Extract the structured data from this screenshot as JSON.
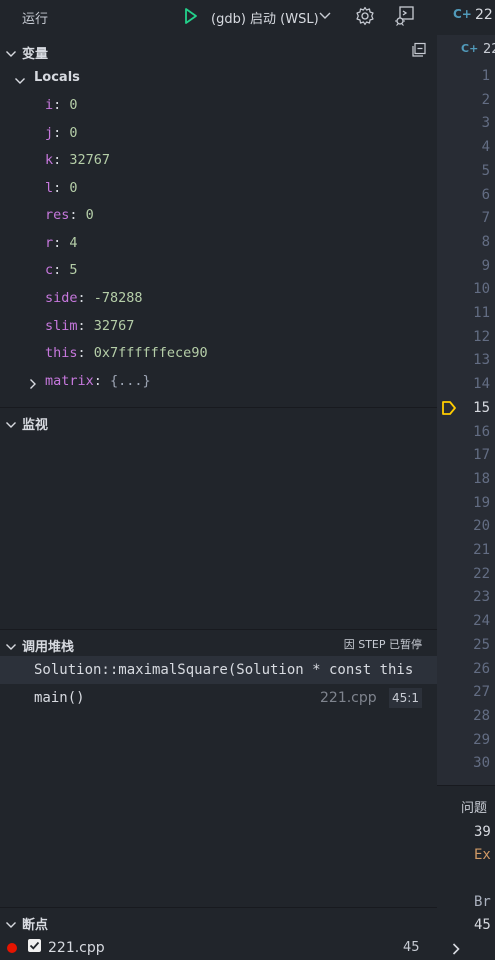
{
  "colors": {
    "accent_play": "#23d18b",
    "breakpoint": "#e51400",
    "debug_arrow": "#ffcc00",
    "var_name": "#c678dd",
    "var_value": "#b5cea8"
  },
  "toolbar": {
    "title": "运行",
    "config": "(gdb) 启动 (WSL)"
  },
  "variables": {
    "header": "变量",
    "scope": "Locals",
    "items": [
      {
        "name": "i",
        "value": "0"
      },
      {
        "name": "j",
        "value": "0"
      },
      {
        "name": "k",
        "value": "32767"
      },
      {
        "name": "l",
        "value": "0"
      },
      {
        "name": "res",
        "value": "0"
      },
      {
        "name": "r",
        "value": "4"
      },
      {
        "name": "c",
        "value": "5"
      },
      {
        "name": "side",
        "value": "-78288"
      },
      {
        "name": "slim",
        "value": "32767"
      },
      {
        "name": "this",
        "value": "0x7ffffffece90"
      },
      {
        "name": "matrix",
        "value": "{...}"
      }
    ]
  },
  "watch": {
    "header": "监视"
  },
  "callstack": {
    "header": "调用堆栈",
    "status": "因 STEP 已暂停",
    "frames": [
      {
        "name": "Solution::maximalSquare(Solution * const this",
        "file": "",
        "pos": ""
      },
      {
        "name": "main()",
        "file": "221.cpp",
        "pos": "45:1"
      }
    ]
  },
  "breakpoints": {
    "header": "断点",
    "items": [
      {
        "file": "221.cpp",
        "line": "45"
      }
    ]
  },
  "editor": {
    "tab_label": "22",
    "breadcrumb": "22",
    "line_numbers": [
      "1",
      "2",
      "3",
      "4",
      "5",
      "6",
      "7",
      "8",
      "9",
      "10",
      "11",
      "12",
      "13",
      "14",
      "15",
      "16",
      "17",
      "18",
      "19",
      "20",
      "21",
      "22",
      "23",
      "24",
      "25",
      "26",
      "27",
      "28",
      "29",
      "30"
    ],
    "current_line": "15",
    "panel_tab": "问题",
    "panel_lines": [
      "39",
      "Ex",
      "",
      "Br",
      "45"
    ]
  }
}
